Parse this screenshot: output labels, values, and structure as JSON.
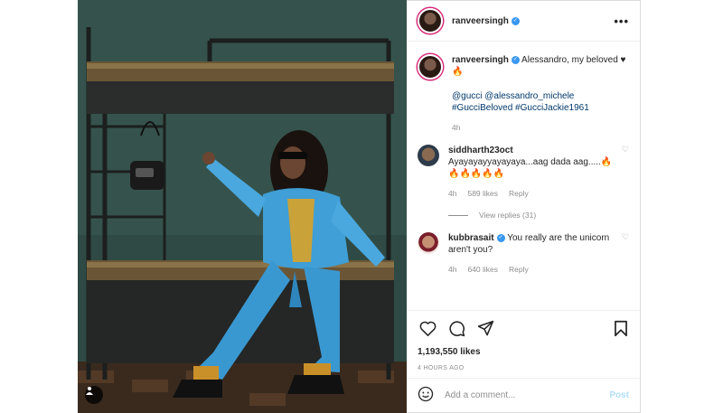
{
  "post": {
    "author": "ranveersingh",
    "verified": true,
    "caption_text": "Alessandro, my beloved ♥🔥",
    "caption_tags": "@gucci @alessandro_michele #GucciBeloved #GucciJackie1961",
    "caption_time": "4h",
    "likes": "1,193,550 likes",
    "posted": "4 HOURS AGO"
  },
  "comments": [
    {
      "user": "siddharth23oct",
      "verified": false,
      "text": "Ayayayayyayayaya...aag dada aag.....🔥🔥🔥🔥🔥🔥",
      "time": "4h",
      "likes": "589 likes",
      "reply": "Reply",
      "view_replies": "View replies (31)"
    },
    {
      "user": "kubbrasait",
      "verified": true,
      "text": "You really are the unicorn aren't you?",
      "time": "4h",
      "likes": "640 likes",
      "reply": "Reply"
    }
  ],
  "add_comment": {
    "placeholder": "Add a comment...",
    "post_label": "Post"
  },
  "icons": {
    "more": "more-options-icon",
    "like": "heart-icon",
    "comment": "comment-icon",
    "share": "share-icon",
    "save": "bookmark-icon",
    "emoji": "emoji-icon",
    "tag": "user-tag-icon"
  },
  "colors": {
    "verified": "#3897f0",
    "link": "#00376b",
    "post_button": "#b2dffc",
    "muted": "#8e8e8e"
  }
}
